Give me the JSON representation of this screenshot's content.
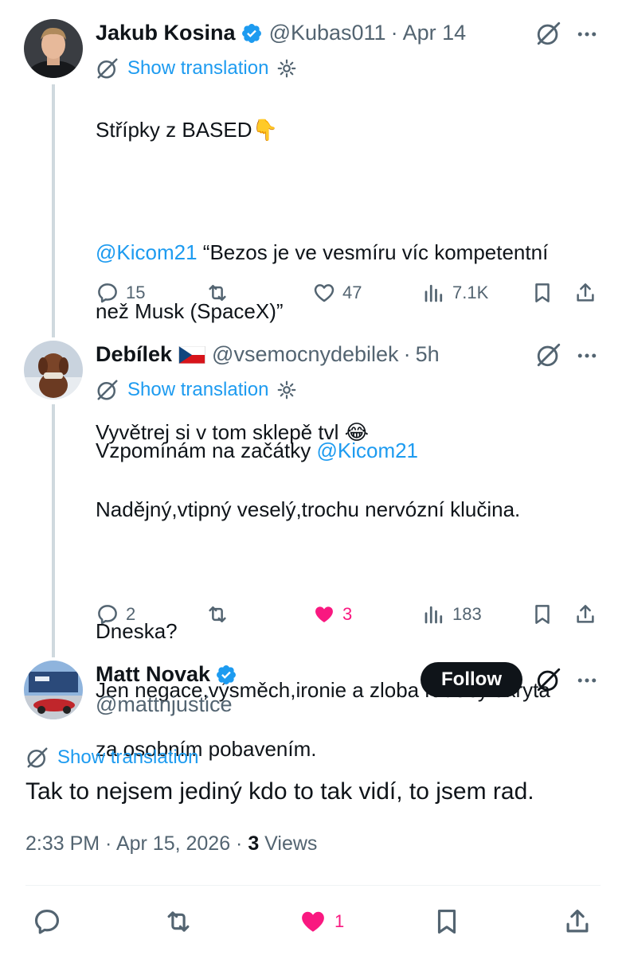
{
  "tweets": [
    {
      "name": "Jakub Kosina",
      "handle": "@Kubas011",
      "separator": "·",
      "time": "Apr 14",
      "verified": true,
      "translate": "Show translation",
      "lines": [
        {
          "text": "Střípky z BASED",
          "emoji": "👇"
        },
        {
          "mention": "@Kicom21",
          "text": " “Bezos je ve vesmíru víc kompetentní"
        },
        {
          "text": "než Musk (SpaceX)”"
        },
        {
          "text": "Vyvětrej si v tom sklepě tvl ",
          "emoji": "😂"
        }
      ],
      "stats": {
        "replies": "15",
        "retweets": "",
        "likes": "47",
        "views": "7.1K"
      }
    },
    {
      "name": "Debílek",
      "handle": "@vsemocnydebilek",
      "separator": "·",
      "time": "5h",
      "flag": "czech-flag",
      "translate": "Show translation",
      "lines": [
        {
          "text": "Vzpomínám na začátky ",
          "mention": "@Kicom21"
        },
        {
          "text": "Nadějný,vtipný veselý,trochu nervózní klučina."
        },
        {
          "text": "Dneska?"
        },
        {
          "text": "Jen negace,výsměch,ironie a zloba rádoby ukrytá"
        },
        {
          "text": "za osobním pobavením."
        }
      ],
      "stats": {
        "replies": "2",
        "retweets": "",
        "likes": "3",
        "views": "183"
      }
    }
  ],
  "main_tweet": {
    "name": "Matt Novak",
    "handle": "@mattnjustice",
    "verified": true,
    "follow_label": "Follow",
    "translate": "Show translation",
    "text": "Tak to nejsem jediný kdo to tak vidí, to jsem rad.",
    "timestamp": "2:33 PM · Apr 15, 2026 · ",
    "views_count": "3",
    "views_label": " Views",
    "likes": "1"
  },
  "colors": {
    "accent": "#1d9bf0",
    "like": "#f91880",
    "muted": "#536471",
    "text": "#0f1419"
  }
}
